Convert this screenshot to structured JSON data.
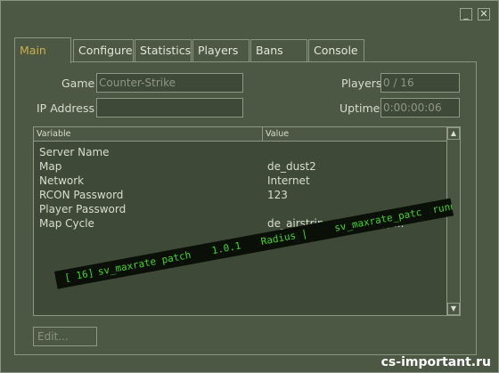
{
  "window": {
    "minimize_glyph": "_",
    "close_glyph": "✕"
  },
  "tabs": [
    {
      "label": "Main",
      "active": true
    },
    {
      "label": "Configure"
    },
    {
      "label": "Statistics"
    },
    {
      "label": "Players"
    },
    {
      "label": "Bans"
    },
    {
      "label": "Console"
    }
  ],
  "main": {
    "game_label": "Game",
    "game_value": "Counter-Strike",
    "ip_label": "IP Address",
    "ip_value": "",
    "players_label": "Players",
    "players_value": "0 / 16",
    "uptime_label": "Uptime",
    "uptime_value": "0:00:00:06"
  },
  "list": {
    "col_variable": "Variable",
    "col_value": "Value",
    "rows": [
      {
        "variable": "Server Name",
        "value": ""
      },
      {
        "variable": "Map",
        "value": "de_dust2"
      },
      {
        "variable": "Network",
        "value": "Internet"
      },
      {
        "variable": "RCON Password",
        "value": "123"
      },
      {
        "variable": "Player Password",
        "value": ""
      },
      {
        "variable": "Map Cycle",
        "value": "de_airstrip, cs_havana, ..."
      }
    ],
    "scroll_up_glyph": "▲",
    "scroll_down_glyph": "▼"
  },
  "edit_button": "Edit...",
  "ticker": {
    "slot": "[ 16]",
    "name": "sv_maxrate patch",
    "version": "1.0.1",
    "author": "Radius |",
    "plugin": "sv_maxrate_patc",
    "status": "running"
  },
  "watermark": "cs-important.ru"
}
